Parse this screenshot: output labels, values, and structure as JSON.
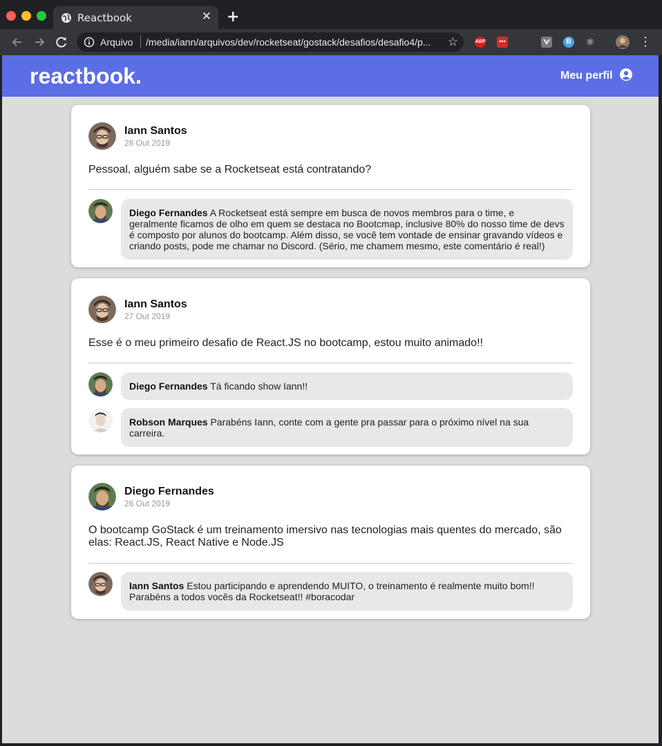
{
  "browser": {
    "tab_title": "Reactbook",
    "address_scheme_label": "Arquivo",
    "address_url": "/media/iann/arquivos/dev/rocketseat/gostack/desafios/desafio4/p...",
    "extensions": [
      "abp-icon",
      "lastpass-icon",
      "vue-devtools-icon",
      "b-extension-icon",
      "react-devtools-icon"
    ],
    "abp_label": "ABP",
    "lastpass_label": "•••",
    "b_label": "B",
    "react_glyph": "⚛"
  },
  "header": {
    "logo": "reactbook.",
    "profile_label": "Meu perfil"
  },
  "colors": {
    "header_bg": "#5b6ee6",
    "page_bg": "#dcdcdc",
    "bubble_bg": "#e8e8e8"
  },
  "posts": [
    {
      "author": "Iann Santos",
      "date": "28 Out 2019",
      "content": "Pessoal, alguém sabe se a Rocketseat está contratando?",
      "comments": [
        {
          "author": "Diego Fernandes",
          "text": "A Rocketseat está sempre em busca de novos membros para o time, e geralmente ficamos de olho em quem se destaca no Bootcmap, inclusive 80% do nosso time de devs é composto por alunos do bootcamp. Além disso, se você tem vontade de ensinar gravando vídeos e criando posts, pode me chamar no Discord. (Sério, me chamem mesmo, este comentário é real!)"
        }
      ]
    },
    {
      "author": "Iann Santos",
      "date": "27 Out 2019",
      "content": "Esse é o meu primeiro desafio de React.JS no bootcamp, estou muito animado!!",
      "comments": [
        {
          "author": "Diego Fernandes",
          "text": "Tá ficando show Iann!!"
        },
        {
          "author": "Robson Marques",
          "text": "Parabéns Iann, conte com a gente pra passar para o próximo nível na sua carreira."
        }
      ]
    },
    {
      "author": "Diego Fernandes",
      "date": "26 Out 2019",
      "content": "O bootcamp GoStack é um treinamento imersivo nas tecnologias mais quentes do mercado, são elas: React.JS, React Native e Node.JS",
      "comments": [
        {
          "author": "Iann Santos",
          "text": "Estou participando e aprendendo MUITO, o treinamento é realmente muito bom!! Parabéns a todos vocês da Rocketseat!! #boracodar"
        }
      ]
    }
  ]
}
